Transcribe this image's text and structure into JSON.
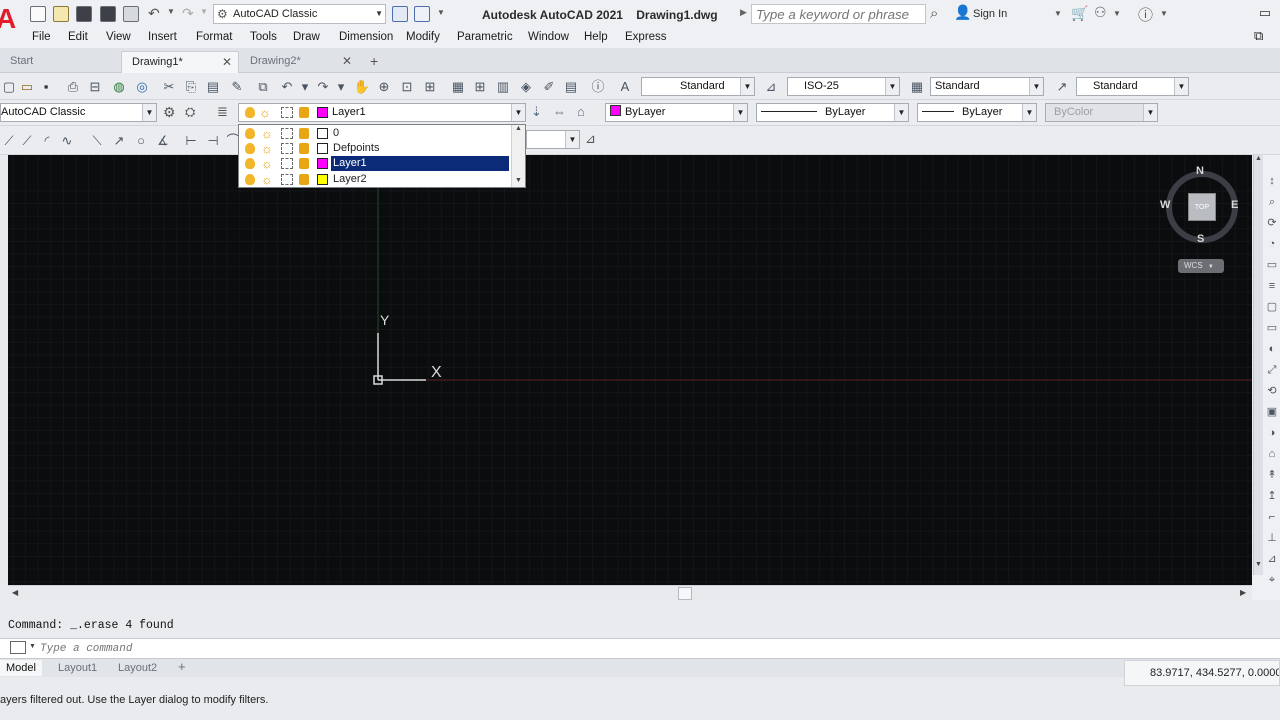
{
  "app": {
    "title": "Autodesk AutoCAD 2021    Drawing1.dwg",
    "logo_letter": "A",
    "workspace": "AutoCAD Classic",
    "search_placeholder": "Type a keyword or phrase",
    "sign_in": "Sign In"
  },
  "menu": [
    "File",
    "Edit",
    "View",
    "Insert",
    "Format",
    "Tools",
    "Draw",
    "Dimension",
    "Modify",
    "Parametric",
    "Window",
    "Help",
    "Express"
  ],
  "tabs": [
    {
      "label": "Start"
    },
    {
      "label": "Drawing1*"
    },
    {
      "label": "Drawing2*"
    }
  ],
  "styles_toolbar": {
    "text_style": "Standard",
    "dim_style": "ISO-25",
    "table_style": "Standard",
    "mleader_style": "Standard"
  },
  "layers_toolbar": {
    "workspace": "AutoCAD Classic",
    "current_layer": "Layer1",
    "color": "ByLayer",
    "linetype": "ByLayer",
    "lineweight": "ByLayer",
    "plot_style": "ByColor"
  },
  "layer_dropdown": [
    {
      "name": "0",
      "color": "#ffffff",
      "selected": false
    },
    {
      "name": "Defpoints",
      "color": "#ffffff",
      "selected": false
    },
    {
      "name": "Layer1",
      "color": "#ff00ff",
      "selected": true
    },
    {
      "name": "Layer2",
      "color": "#ffff00",
      "selected": false
    }
  ],
  "viewcube": {
    "north": "N",
    "south": "S",
    "east": "E",
    "west": "W",
    "face": "TOP",
    "ucs": "WCS"
  },
  "ucs_icon": {
    "x_label": "X",
    "y_label": "Y"
  },
  "command": {
    "history": "Command: _.erase 4 found",
    "placeholder": "Type a command"
  },
  "layout_tabs": [
    "Model",
    "Layout1",
    "Layout2"
  ],
  "status": {
    "coordinates": "83.9717, 434.5277, 0.0000",
    "message": "ayers filtered out.  Use the Layer dialog to modify filters."
  },
  "colors": {
    "canvas": "#0b0c0e",
    "grid": "#1b1e22",
    "selection": "#0b2a78",
    "axis_x": "#5a1f24",
    "axis_y": "#1e4a26",
    "brand": "#e01e2b"
  }
}
